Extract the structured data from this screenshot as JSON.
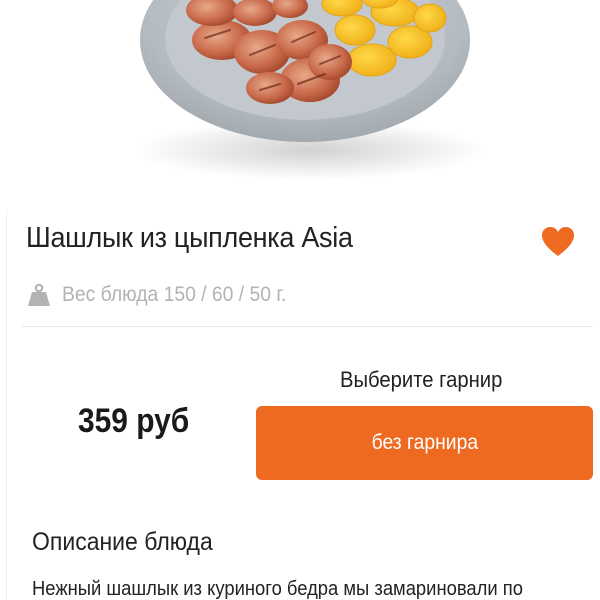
{
  "dish": {
    "title": "Шашлык из цыпленка Asia",
    "weight": "Вес блюда 150 / 60 / 50 г.",
    "price": "359 руб",
    "favorited": true
  },
  "garnish": {
    "prompt": "Выберите гарнир",
    "selected": "без гарнира"
  },
  "description": {
    "title": "Описание блюда",
    "text": "Нежный шашлык из куриного бедра мы замариновали по"
  },
  "colors": {
    "accent": "#ee6a21",
    "muted_text": "#b3b3b3",
    "divider": "#e6e6e6"
  },
  "icons": {
    "favorite": "heart-icon",
    "weight": "weight-icon"
  }
}
